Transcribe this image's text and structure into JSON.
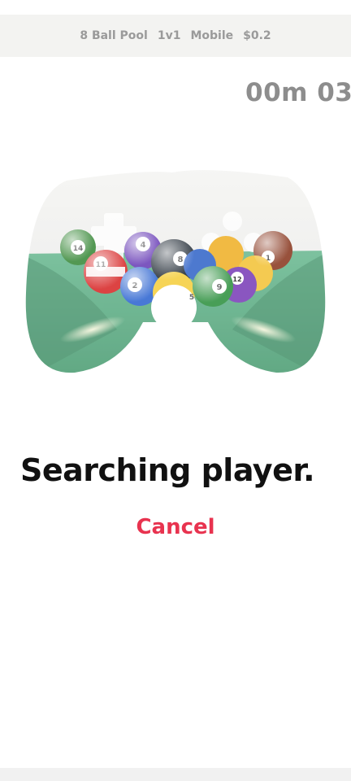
{
  "match_header": {
    "game": "8 Ball Pool",
    "mode": "1v1",
    "platform": "Mobile",
    "fee": "$0.2"
  },
  "timer": {
    "text": "00m 03"
  },
  "hero_image": {
    "icon": "gamepad-billiards-icon",
    "balls": [
      "14",
      "4",
      "8",
      "11",
      "2",
      "9",
      "12",
      "1",
      "5"
    ]
  },
  "status": {
    "text": "Searching player."
  },
  "cancel": {
    "label": "Cancel"
  },
  "colors": {
    "accent": "#e8334f",
    "header_bg": "#f3f3f1",
    "felt": "#3f9a6a"
  }
}
